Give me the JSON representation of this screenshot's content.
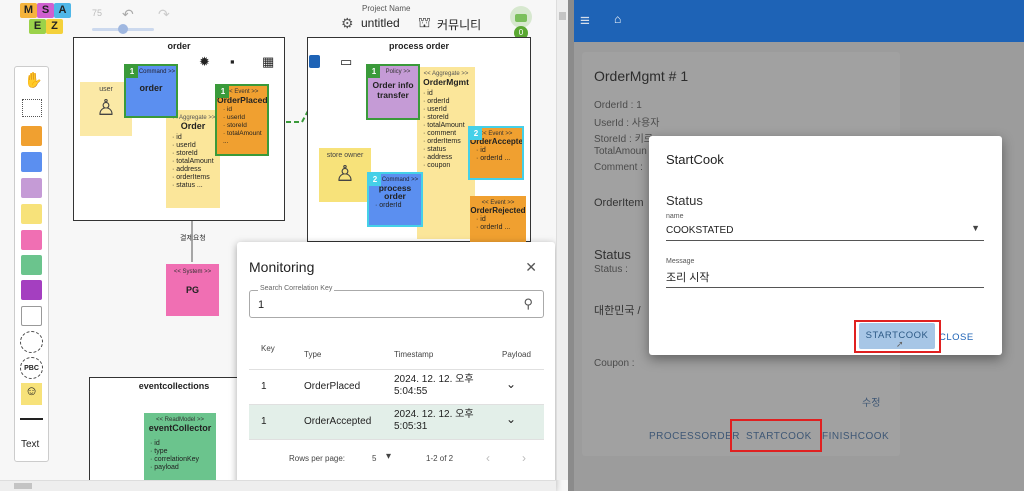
{
  "toolbar": {
    "zoom_value": "75",
    "project_name_label": "Project Name",
    "project_name": "untitled",
    "community_label": "커뮤니티",
    "notification_count": "0",
    "logo_letters": [
      "M",
      "S",
      "A",
      "E",
      "Z"
    ]
  },
  "palette": {
    "text_tool_label": "Text",
    "pbc_label": "PBC"
  },
  "canvas": {
    "order_bc": {
      "title": "order",
      "actor_user": "user",
      "command_label": "Command >>",
      "command_num": "1",
      "command_name": "order",
      "aggregate_label": "<< Aggregate >>",
      "aggregate_name": "Order",
      "aggregate_fields": [
        "id",
        "userId",
        "storeId",
        "totalAmount",
        "address",
        "orderItems",
        "status ..."
      ],
      "event_label": "<< Event >>",
      "event_num": "1",
      "event_name": "OrderPlaced",
      "event_fields": [
        "id",
        "userId",
        "storeId",
        "totalAmount ..."
      ]
    },
    "payment_request_label": "결제요청",
    "pg": {
      "label": "<< System >>",
      "name": "PG"
    },
    "process_order_bc": {
      "title": "process order",
      "policy_label": "Policy >>",
      "policy_num": "1",
      "policy_name": "Order info transfer",
      "aggregate_label": "<< Aggregate >>",
      "aggregate_name": "OrderMgmt",
      "aggregate_fields": [
        "id",
        "orderId",
        "userId",
        "storeId",
        "totalAmount",
        "comment",
        "orderItems",
        "status",
        "address",
        "coupon"
      ],
      "actor_store": "store owner",
      "command_label": "Command >>",
      "command_num": "2",
      "command_name": "process order",
      "command_fields": [
        "orderId"
      ],
      "event_accepted_label": "<< Event >>",
      "event_accepted_num": "2",
      "event_accepted_name": "OrderAccepted",
      "event_accepted_fields": [
        "id",
        "orderId ..."
      ],
      "event_rejected_label": "<< Event >>",
      "event_rejected_name": "OrderRejected",
      "event_rejected_fields": [
        "id",
        "orderId ..."
      ]
    },
    "event_collections_bc": {
      "title": "eventcollections",
      "readmodel_label": "<< ReadModel >>",
      "readmodel_name": "eventCollector",
      "readmodel_fields": [
        "id",
        "type",
        "correlationKey",
        "payload"
      ]
    }
  },
  "monitoring": {
    "title": "Monitoring",
    "search_label": "Search Correlation Key",
    "search_value": "1",
    "columns": [
      "Key",
      "Type",
      "Timestamp",
      "Payload"
    ],
    "rows": [
      {
        "key": "1",
        "type": "OrderPlaced",
        "timestamp": "2024. 12. 12. 오후 5:04:55"
      },
      {
        "key": "1",
        "type": "OrderAccepted",
        "timestamp": "2024. 12. 12. 오후 5:05:31"
      }
    ],
    "rows_per_page_label": "Rows per page:",
    "rows_per_page_value": "5",
    "range_label": "1-2 of 2"
  },
  "right_panel": {
    "card_title": "OrderMgmt # 1",
    "order_id": "OrderId : 1",
    "user_id": "UserId : 사용자",
    "store_id": "StoreId : 키르",
    "total_amount": "TotalAmoun",
    "comment": "Comment :",
    "order_item": "OrderItem",
    "status_heading": "Status",
    "status_field": "Status :",
    "address": "대한민국 /",
    "coupon": "Coupon :",
    "edit_label": "수정",
    "action_buttons": [
      "PROCESSORDER",
      "STARTCOOK",
      "FINISHCOOK"
    ]
  },
  "start_cook_dialog": {
    "title": "StartCook",
    "section_title": "Status",
    "name_label": "name",
    "name_value": "COOKSTATED",
    "message_label": "Message",
    "message_value": "조리 시작",
    "confirm_button": "STARTCOOK",
    "close_button": "CLOSE"
  },
  "colors": {
    "command": "#5b8ff0",
    "event": "#f0a030",
    "policy": "#c59bd6",
    "aggregate": "#fbe69a",
    "actor": "#f7e27a",
    "system": "#f06fb3",
    "readmodel": "#6bc48d",
    "topbar": "#1e63b6",
    "accent_blue": "#1e63b6",
    "highlight_red": "#e02020"
  }
}
